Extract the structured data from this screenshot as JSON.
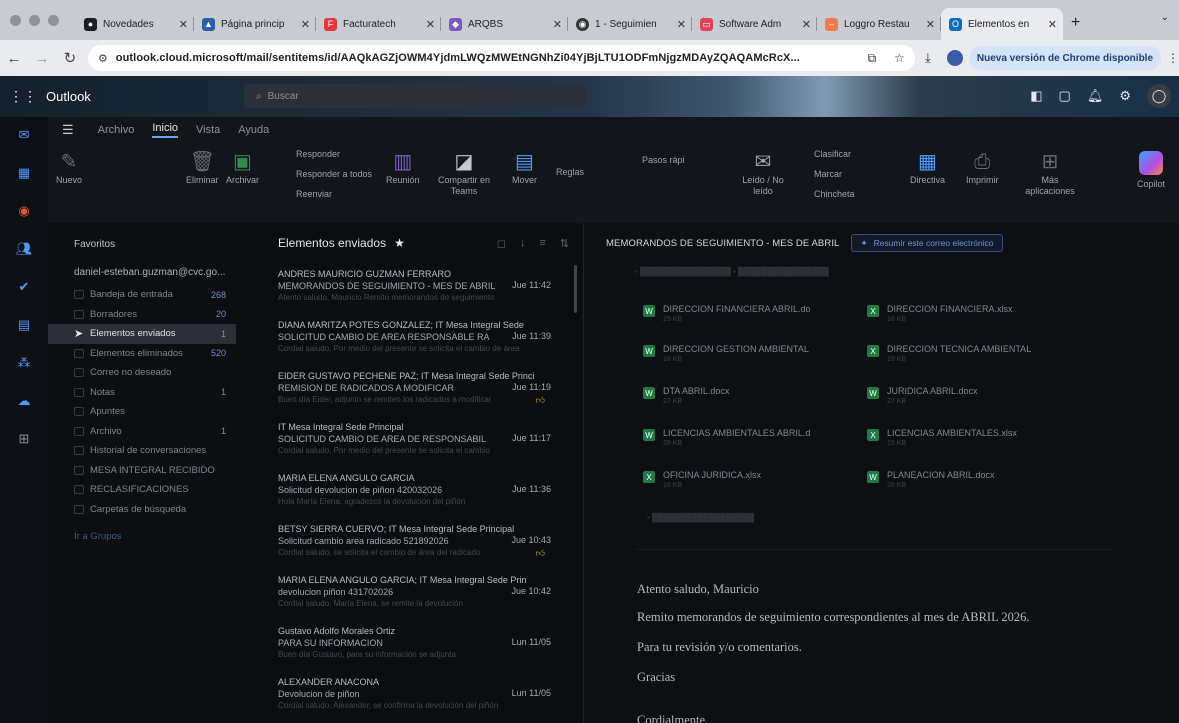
{
  "browser": {
    "tabs": [
      {
        "label": "Novedades",
        "icon": "github-icon",
        "color": "#1b1f23"
      },
      {
        "label": "Página princip",
        "icon": "chart-icon",
        "color": "#2b5ea7"
      },
      {
        "label": "Facturatech",
        "icon": "facturatech-icon",
        "color": "#e03a3a"
      },
      {
        "label": "ARQBS",
        "icon": "arqbs-icon",
        "color": "#7e57c2"
      },
      {
        "label": "1 - Seguimien",
        "icon": "web-icon",
        "color": "#333333"
      },
      {
        "label": "Software Adm",
        "icon": "software-icon",
        "color": "#e0445a"
      },
      {
        "label": "Loggro Restau",
        "icon": "loggro-icon",
        "color": "#ef7b45"
      },
      {
        "label": "Elementos en",
        "icon": "outlook-icon",
        "color": "#0f6cbd"
      }
    ],
    "url": "outlook.cloud.microsoft/mail/sentitems/id/AAQkAGZjOWM4YjdmLWQzMWEtNGNhZi04YjBjLTU1ODFmNjgzMDAyZQAQAMcRcX...",
    "update_label": "Nueva versión de Chrome disponible"
  },
  "outlook": {
    "brand": "Outlook",
    "search_placeholder": "Buscar"
  },
  "ribbon": {
    "tabs": [
      "Archivo",
      "Inicio",
      "Vista",
      "Ayuda"
    ],
    "active_tab": "Inicio",
    "buttons": {
      "nuevo": "Nuevo",
      "eliminar": "Eliminar",
      "archivar": "Archivar",
      "responder": "Responder",
      "responder_todos": "Responder a todos",
      "reenviar": "Reenviar",
      "reunion": "Reunión",
      "compartir": "Compartir en Teams",
      "mover": "Mover",
      "reglas": "Reglas",
      "pasos": "Pasos rápi",
      "leido": "Leído / No leído",
      "clasificar": "Clasificar",
      "marcar": "Marcar",
      "chincheta": "Chincheta",
      "directiva": "Directiva",
      "imprimir": "Imprimir",
      "mas_apps": "Más aplicaciones",
      "copilot": "Copilot"
    }
  },
  "folders": {
    "header": "Favoritos",
    "account": "daniel-esteban.guzman@cvc.go...",
    "items": [
      {
        "label": "Bandeja de entrada",
        "count": "268"
      },
      {
        "label": "Borradores",
        "count": "20"
      },
      {
        "label": "Elementos enviados",
        "count": "1"
      },
      {
        "label": "Elementos eliminados",
        "count": "520"
      },
      {
        "label": "Correo no deseado",
        "count": ""
      },
      {
        "label": "Notas",
        "count": "1"
      },
      {
        "label": "Apuntes",
        "count": ""
      },
      {
        "label": "Archivo",
        "count": "1"
      },
      {
        "label": "Historial de conversaciones",
        "count": ""
      },
      {
        "label": "MESA INTEGRAL RECIBIDO",
        "count": ""
      },
      {
        "label": "RECLASIFICACIONES",
        "count": ""
      },
      {
        "label": "Carpetas de búsqueda",
        "count": ""
      }
    ],
    "groups_link": "Ir a Grupos"
  },
  "list": {
    "title": "Elementos enviados",
    "messages": [
      {
        "from": "ANDRES MAURICIO GUZMAN FERRARO",
        "subject": "MEMORANDOS DE SEGUIMIENTO - MES DE ABRIL",
        "time": "Jue 11:42",
        "preview": "Atento saludo, Mauricio Remito memorandos de seguimiento"
      },
      {
        "from": "DIANA MARITZA POTES GONZALEZ; IT Mesa Integral Sede",
        "subject": "SOLICITUD CAMBIO DE AREA RESPONSABLE RA",
        "time": "Jue 11:39",
        "preview": "Cordial saludo, Por medio del presente se solicita el cambio de área"
      },
      {
        "from": "EIDER GUSTAVO PECHENE PAZ; IT Mesa Integral Sede Princi",
        "subject": "REMISION DE RADICADOS A MODIFICAR",
        "time": "Jue 11:19",
        "preview": "Buen día Eider, adjunto se remiten los radicados a modificar"
      },
      {
        "from": "IT Mesa Integral Sede Principal",
        "subject": "SOLICITUD CAMBIO DE AREA DE RESPONSABIL",
        "time": "Jue 11:17",
        "preview": "Cordial saludo, Por medio del presente se solicita el cambio"
      },
      {
        "from": "MARIA ELENA ANGULO GARCIA",
        "subject": "Solicitud devolucion de piñon 420032026",
        "time": "Jue 11:36",
        "preview": "Hola María Elena, agradezco la devolución del piñón"
      },
      {
        "from": "BETSY SIERRA CUERVO; IT Mesa Integral Sede Principal",
        "subject": "Solicitud cambio area radicado 521892026",
        "time": "Jue 10:43",
        "preview": "Cordial saludo, se solicita el cambio de área del radicado"
      },
      {
        "from": "MARIA ELENA ANGULO GARCIA; IT Mesa Integral Sede Prin",
        "subject": "devolucion piñon 431702026",
        "time": "Jue 10:42",
        "preview": "Cordial saludo, María Elena, se remite la devolución"
      },
      {
        "from": "Gustavo Adolfo Morales Ortiz",
        "subject": "PARA SU INFORMACION",
        "time": "Lun 11/05",
        "preview": "Buen día Gustavo, para su información se adjunta"
      },
      {
        "from": "ALEXANDER ANACONA",
        "subject": "Devolucion de piñon",
        "time": "Lun 11/05",
        "preview": "Cordial saludo, Alexander, se confirma la devolución del piñón"
      }
    ]
  },
  "reading": {
    "subject": "MEMORANDOS DE SEGUIMIENTO - MES DE ABRIL",
    "summarize": "Resumir este correo electrónico",
    "attachments": [
      {
        "name": "DIRECCION FINANCIERA ABRIL.do",
        "size": "29 KB"
      },
      {
        "name": "DIRECCION FINANCIERA.xlsx",
        "size": "16 KB"
      },
      {
        "name": "DIRECCION GESTION AMBIENTAL",
        "size": "18 KB"
      },
      {
        "name": "DIRECCION TECNICA AMBIENTAL",
        "size": "19 KB"
      },
      {
        "name": "DTA ABRIL.docx",
        "size": "27 KB"
      },
      {
        "name": "JURIDICA ABRIL.docx",
        "size": "27 KB"
      },
      {
        "name": "LICENCIAS AMBIENTALES ABRIL.d",
        "size": "28 KB"
      },
      {
        "name": "LICENCIAS AMBIENTALES.xlsx",
        "size": "15 KB"
      },
      {
        "name": "OFICINA JURIDICA.xlsx",
        "size": "16 KB"
      },
      {
        "name": "PLANEACION ABRIL.docx",
        "size": "28 KB"
      }
    ],
    "body": [
      "Atento saludo, Mauricio",
      "Remito memorandos de seguimiento correspondientes al mes de ABRIL 2026.",
      "Para tu revisión y/o comentarios.",
      "Gracias",
      "Cordialmente,"
    ]
  }
}
